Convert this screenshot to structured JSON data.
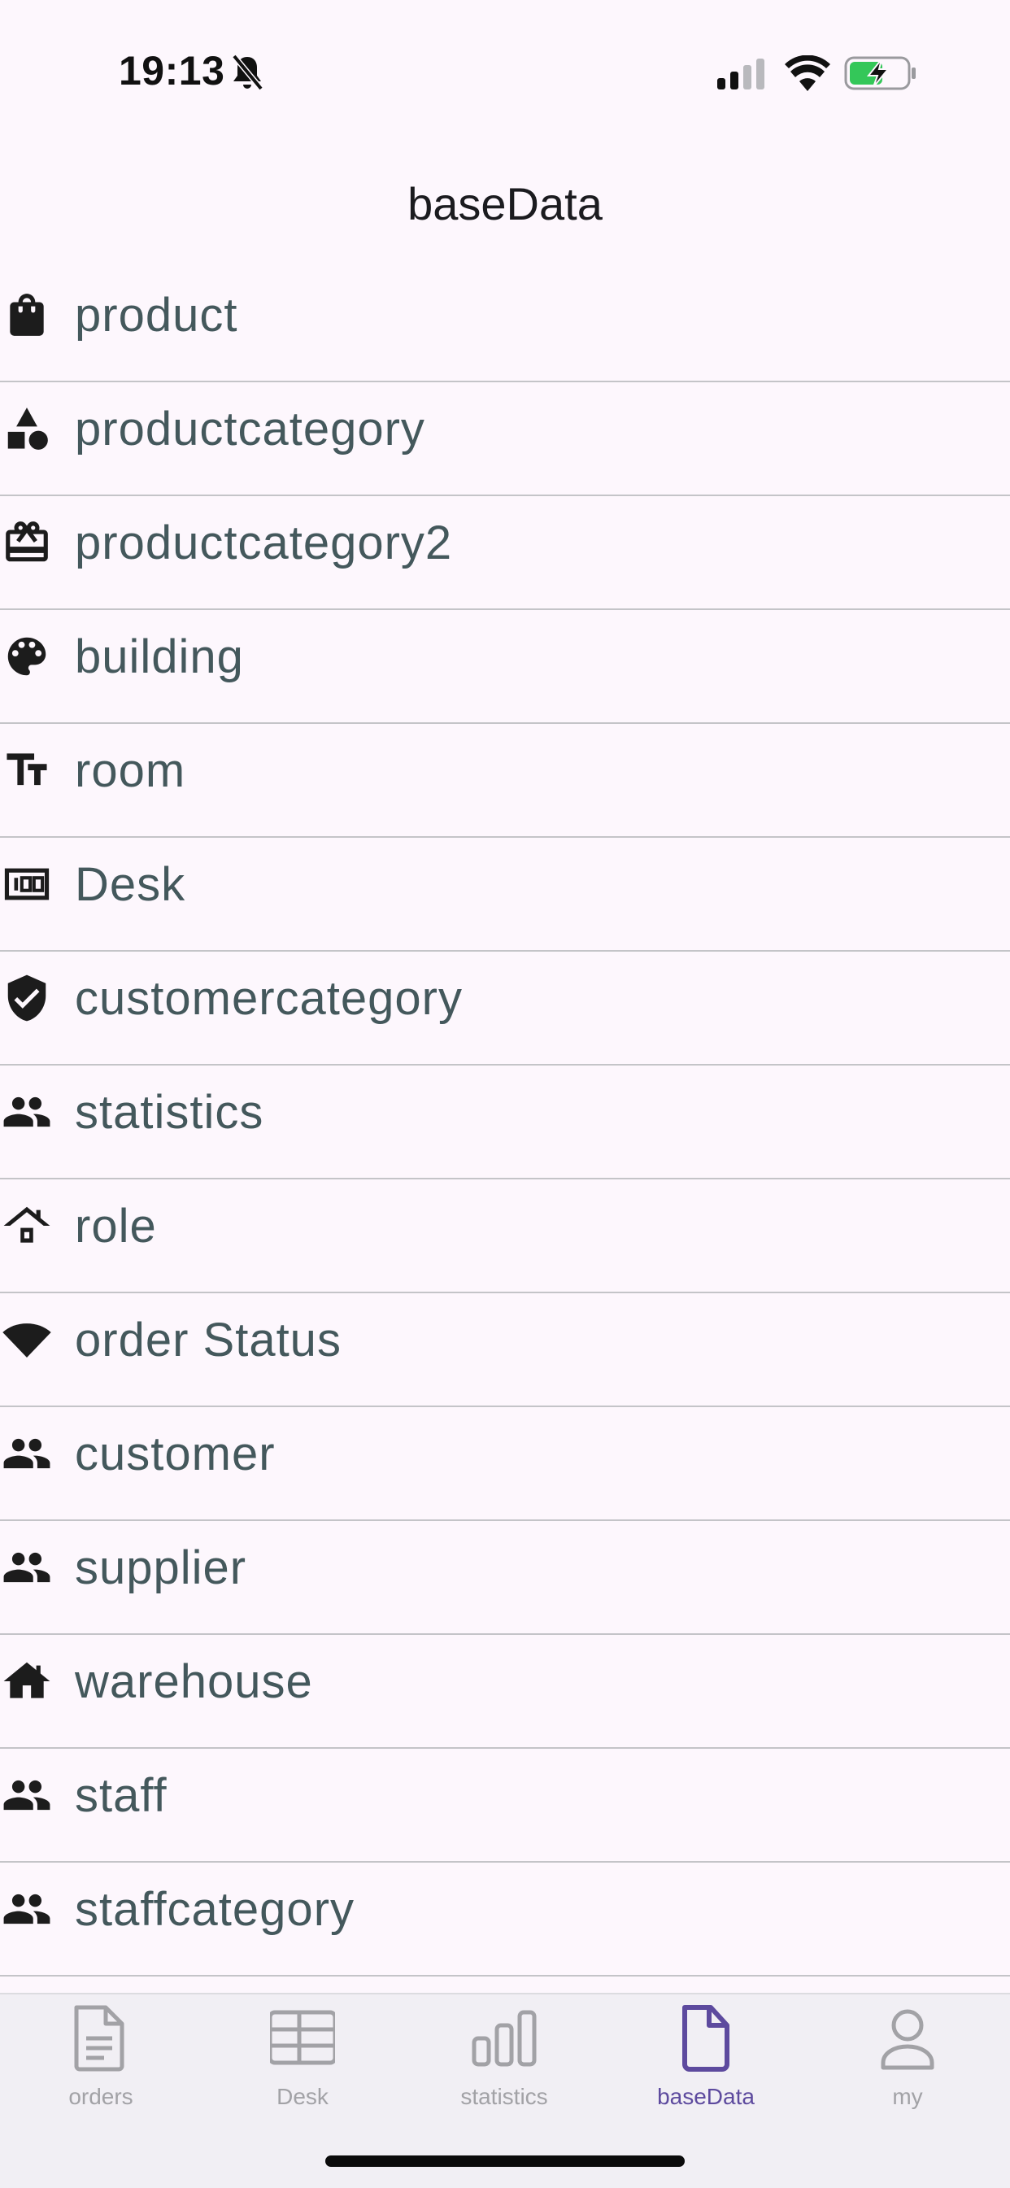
{
  "status_bar": {
    "time": "19:13",
    "icons": [
      "bell-slash-icon",
      "cellular-signal-icon",
      "wifi-icon",
      "battery-charging-icon"
    ],
    "battery_color": "#34c759"
  },
  "header": {
    "title": "baseData"
  },
  "list": {
    "items": [
      {
        "label": "product",
        "icon": "shopping-bag-icon"
      },
      {
        "label": "productcategory",
        "icon": "category-shapes-icon"
      },
      {
        "label": "productcategory2",
        "icon": "card-giftcard-icon"
      },
      {
        "label": "building",
        "icon": "palette-icon"
      },
      {
        "label": "room",
        "icon": "text-fields-icon"
      },
      {
        "label": "Desk",
        "icon": "counter-100-icon"
      },
      {
        "label": "customercategory",
        "icon": "verified-shield-icon"
      },
      {
        "label": "statistics",
        "icon": "people-icon"
      },
      {
        "label": "role",
        "icon": "house-outline-icon"
      },
      {
        "label": "order Status",
        "icon": "wifi-fan-icon"
      },
      {
        "label": "customer",
        "icon": "people-icon"
      },
      {
        "label": "supplier",
        "icon": "people-icon"
      },
      {
        "label": "warehouse",
        "icon": "home-icon"
      },
      {
        "label": "staff",
        "icon": "people-icon"
      },
      {
        "label": "staffcategory",
        "icon": "people-icon"
      }
    ]
  },
  "tab_bar": {
    "active_color": "#5d4a9e",
    "inactive_color": "#a2a2a6",
    "tabs": [
      {
        "label": "orders",
        "icon": "document-icon",
        "active": false
      },
      {
        "label": "Desk",
        "icon": "table-grid-icon",
        "active": false
      },
      {
        "label": "statistics",
        "icon": "bar-chart-icon",
        "active": false
      },
      {
        "label": "baseData",
        "icon": "file-icon",
        "active": true
      },
      {
        "label": "my",
        "icon": "person-icon",
        "active": false
      }
    ]
  }
}
